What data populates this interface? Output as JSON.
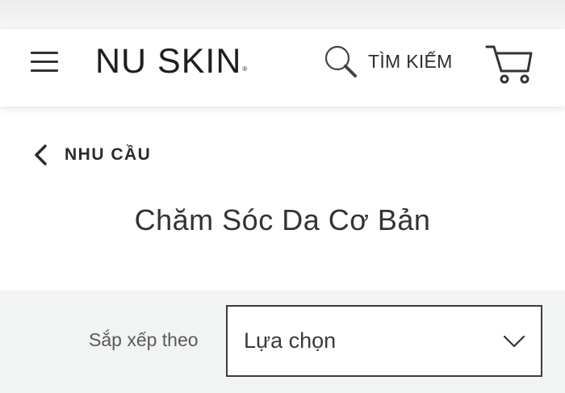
{
  "header": {
    "brand": "NU SKIN",
    "brand_mark": "®",
    "search_label": "TÌM KIẾM",
    "menu_icon": "hamburger-menu-icon",
    "search_icon": "search-icon",
    "cart_icon": "shopping-cart-icon"
  },
  "navigation": {
    "back_label": "NHU CẦU",
    "back_icon": "chevron-left-icon"
  },
  "page": {
    "title": "Chăm Sóc Da Cơ Bản"
  },
  "sort": {
    "label": "Sắp xếp theo",
    "selected": "Lựa chọn",
    "dropdown_icon": "chevron-down-icon"
  }
}
